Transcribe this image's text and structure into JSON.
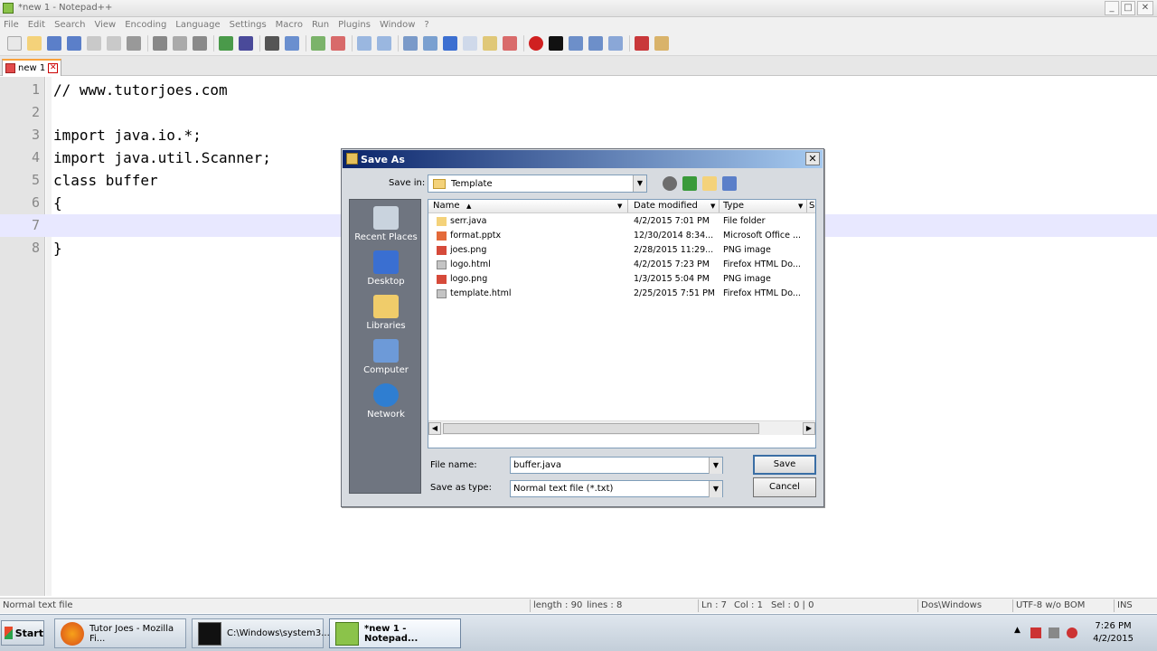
{
  "window": {
    "title": "*new  1 - Notepad++"
  },
  "menu": [
    "File",
    "Edit",
    "Search",
    "View",
    "Encoding",
    "Language",
    "Settings",
    "Macro",
    "Run",
    "Plugins",
    "Window",
    "?"
  ],
  "tab": {
    "label": "new  1"
  },
  "editor": {
    "lines": [
      {
        "num": "1",
        "text": "// www.tutorjoes.com"
      },
      {
        "num": "2",
        "text": ""
      },
      {
        "num": "3",
        "text": "import java.io.*;"
      },
      {
        "num": "4",
        "text": "import java.util.Scanner;"
      },
      {
        "num": "5",
        "text": "class buffer"
      },
      {
        "num": "6",
        "text": "{"
      },
      {
        "num": "7",
        "text": ""
      },
      {
        "num": "8",
        "text": "}"
      }
    ],
    "current_line": 7
  },
  "status": {
    "filetype": "Normal text file",
    "length": "length : 90",
    "lines": "lines : 8",
    "ln": "Ln : 7",
    "col": "Col : 1",
    "sel": "Sel : 0 | 0",
    "eol": "Dos\\Windows",
    "encoding": "UTF-8 w/o BOM",
    "mode": "INS"
  },
  "dialog": {
    "title": "Save As",
    "save_in_label": "Save in:",
    "save_in_value": "Template",
    "places": [
      "Recent Places",
      "Desktop",
      "Libraries",
      "Computer",
      "Network"
    ],
    "columns": [
      "Name",
      "Date modified",
      "Type",
      "S"
    ],
    "files": [
      {
        "name": "serr.java",
        "date": "4/2/2015 7:01 PM",
        "type": "File folder",
        "icon": "folder-icon"
      },
      {
        "name": "format.pptx",
        "date": "12/30/2014 8:34...",
        "type": "Microsoft Office ...",
        "icon": "pptx-icon"
      },
      {
        "name": "joes.png",
        "date": "2/28/2015 11:29...",
        "type": "PNG image",
        "icon": "image-icon"
      },
      {
        "name": "logo.html",
        "date": "4/2/2015 7:23 PM",
        "type": "Firefox HTML Do...",
        "icon": "html-icon"
      },
      {
        "name": "logo.png",
        "date": "1/3/2015 5:04 PM",
        "type": "PNG image",
        "icon": "image-icon"
      },
      {
        "name": "template.html",
        "date": "2/25/2015 7:51 PM",
        "type": "Firefox HTML Do...",
        "icon": "html-icon"
      }
    ],
    "file_name_label": "File name:",
    "file_name_value": "buffer.java",
    "save_type_label": "Save as type:",
    "save_type_value": "Normal text file (*.txt)",
    "save_button": "Save",
    "cancel_button": "Cancel",
    "close_glyph": "✕"
  },
  "taskbar": {
    "start_label": "Start",
    "buttons": [
      {
        "label": "Tutor Joes - Mozilla Fi...",
        "icon": "firefox-icon"
      },
      {
        "label": "C:\\Windows\\system3...",
        "icon": "cmd-icon"
      },
      {
        "label": "*new  1 - Notepad...",
        "icon": "notepad-icon"
      }
    ],
    "time": "7:26 PM",
    "date": "4/2/2015"
  },
  "colors": {
    "dialog_title_start": "#0a246a",
    "dialog_title_end": "#a6caf0",
    "current_line": "#e8e8ff",
    "tab_accent": "#f9a23d"
  }
}
